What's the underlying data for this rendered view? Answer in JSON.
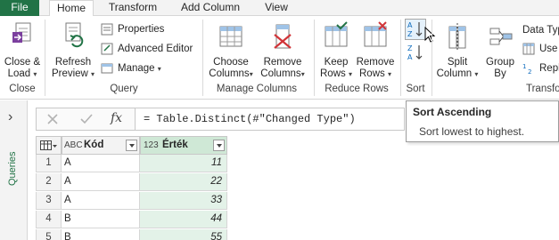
{
  "tabs": {
    "file": "File",
    "home": "Home",
    "transform": "Transform",
    "add_column": "Add Column",
    "view": "View"
  },
  "ribbon": {
    "close_load_line1": "Close &",
    "close_load_line2": "Load",
    "close_group": "Close",
    "refresh_line1": "Refresh",
    "refresh_line2": "Preview",
    "properties": "Properties",
    "advanced_editor": "Advanced Editor",
    "manage": "Manage",
    "query_group": "Query",
    "choose_line1": "Choose",
    "choose_line2": "Columns",
    "remove_cols_line1": "Remove",
    "remove_cols_line2": "Columns",
    "manage_columns_group": "Manage Columns",
    "keep_line1": "Keep",
    "keep_line2": "Rows",
    "remove_rows_line1": "Remove",
    "remove_rows_line2": "Rows",
    "reduce_rows_group": "Reduce Rows",
    "sort_group": "Sort",
    "split_line1": "Split",
    "split_line2": "Column",
    "group_line1": "Group",
    "group_line2": "By",
    "data_type": "Data Typ",
    "use": "Use",
    "repl": "Repl",
    "transform_group": "Transfo"
  },
  "formula_bar": {
    "fx": "fx",
    "formula": "= Table.Distinct(#\"Changed Type\")"
  },
  "tooltip": {
    "title": "Sort Ascending",
    "description": "Sort lowest to highest."
  },
  "queries_pane": {
    "label": "Queries",
    "expand": "›"
  },
  "grid": {
    "columns": [
      {
        "type_icon": "ABC",
        "name": "Kód"
      },
      {
        "type_icon": "123",
        "name": "Érték"
      }
    ],
    "rows": [
      {
        "num": "1",
        "kod": "A",
        "ertek": "11"
      },
      {
        "num": "2",
        "kod": "A",
        "ertek": "22"
      },
      {
        "num": "3",
        "kod": "A",
        "ertek": "33"
      },
      {
        "num": "4",
        "kod": "B",
        "ertek": "44"
      },
      {
        "num": "5",
        "kod": "B",
        "ertek": "55"
      }
    ]
  },
  "colors": {
    "accent": "#217346",
    "selected_column": "#e3f2e8"
  }
}
